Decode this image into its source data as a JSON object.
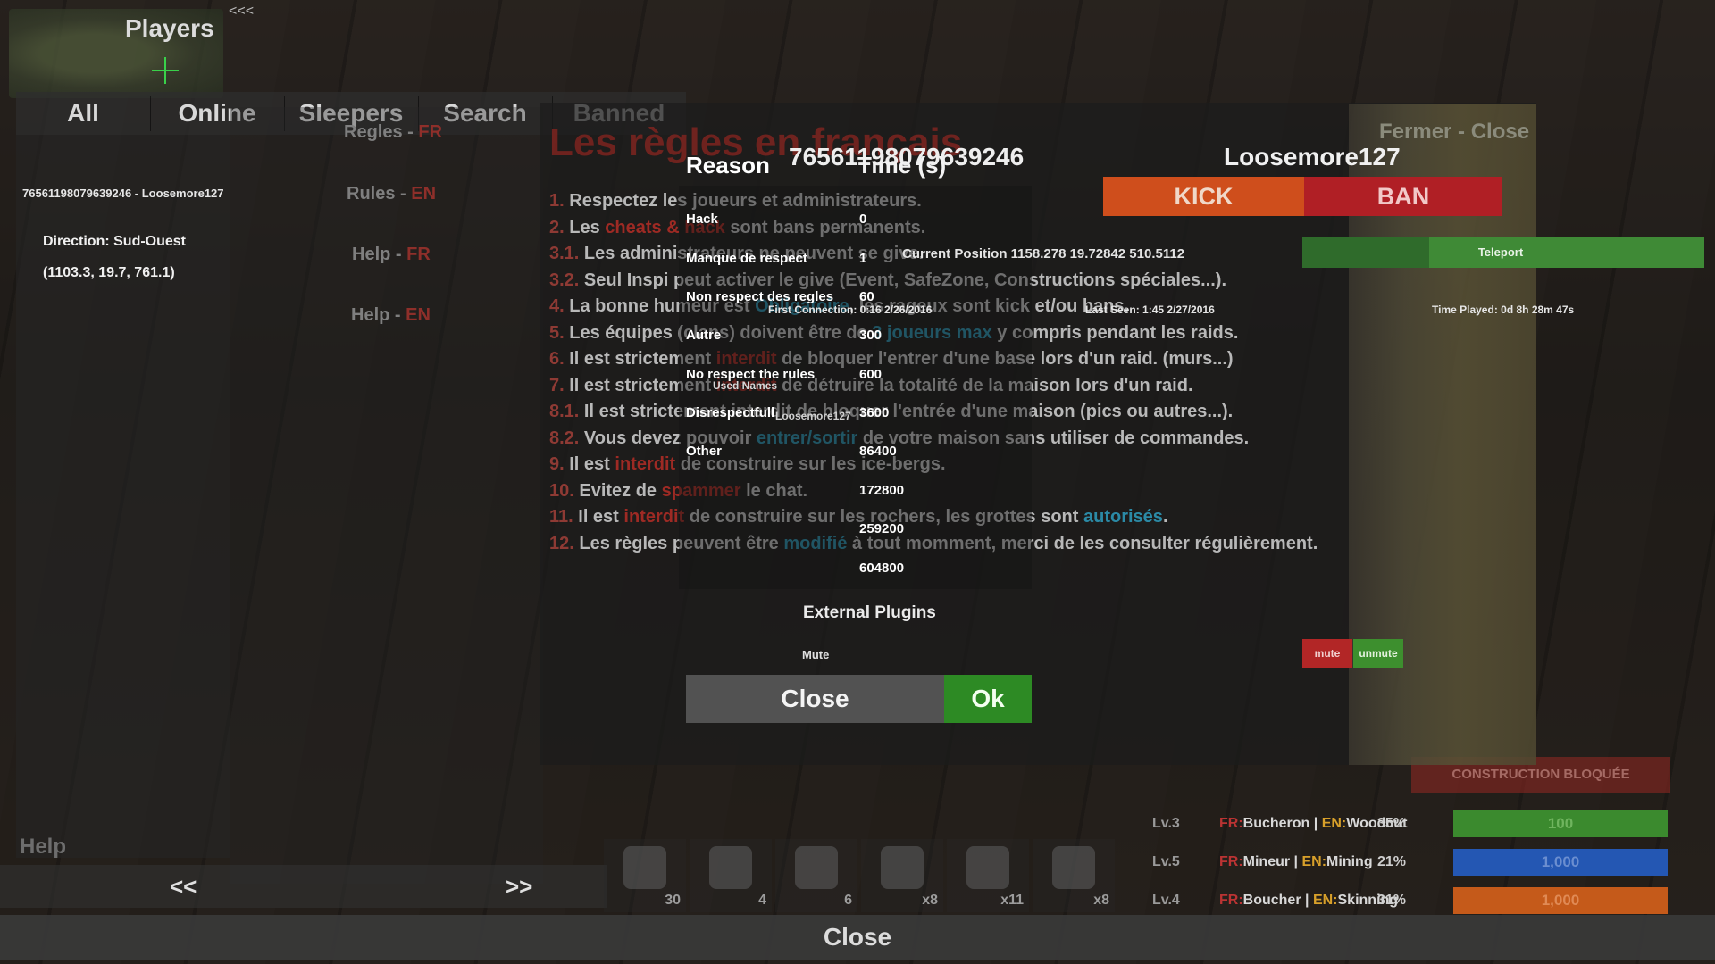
{
  "header": {
    "title": "Players",
    "collapse_label": "<<<",
    "tabs": [
      "All",
      "Online",
      "Sleepers",
      "Search",
      "Banned"
    ]
  },
  "left": {
    "player_entry": "76561198079639246 - Loosemore127",
    "direction": "Direction: Sud-Ouest",
    "coords": "(1103.3, 19.7, 761.1)",
    "help": "Help",
    "prev": "<<",
    "next": ">>"
  },
  "rules_nav": [
    {
      "label": "Regles - ",
      "lang": "FR"
    },
    {
      "label": "Rules - ",
      "lang": "EN"
    },
    {
      "label": "Help - ",
      "lang": "FR"
    },
    {
      "label": "Help - ",
      "lang": "EN"
    }
  ],
  "rules": {
    "title": "Les règles en français",
    "items": [
      [
        {
          "t": "1. ",
          "c": "n"
        },
        {
          "t": "Respectez les joueurs et administrateurs."
        }
      ],
      [
        {
          "t": "2. ",
          "c": "n"
        },
        {
          "t": "Les "
        },
        {
          "t": "cheats & hack",
          "c": "r"
        },
        {
          "t": " sont bans permanents."
        }
      ],
      [
        {
          "t": "3.1. ",
          "c": "n"
        },
        {
          "t": "Les administrateurs ne peuvent se give."
        }
      ],
      [
        {
          "t": "3.2. ",
          "c": "n"
        },
        {
          "t": "Seul Inspi peut activer le give (Event, SafeZone, Constructions spéciales...)."
        }
      ],
      [
        {
          "t": "4. ",
          "c": "n"
        },
        {
          "t": "La bonne humeur est "
        },
        {
          "t": "Obligatoire",
          "c": "b"
        },
        {
          "t": ", les rageux sont kick et/ou bans."
        }
      ],
      [
        {
          "t": "5. ",
          "c": "n"
        },
        {
          "t": "Les équipes (clans) doivent être de "
        },
        {
          "t": "3 joueurs max",
          "c": "b"
        },
        {
          "t": " y compris pendant les raids."
        }
      ],
      [
        {
          "t": "6. ",
          "c": "n"
        },
        {
          "t": "Il est strictement "
        },
        {
          "t": "interdit",
          "c": "r"
        },
        {
          "t": " de bloquer l'entrer d'une base lors d'un raid. (murs...)"
        }
      ],
      [
        {
          "t": "7. ",
          "c": "n"
        },
        {
          "t": "Il est strictement "
        },
        {
          "t": "interdit",
          "c": "r"
        },
        {
          "t": " de détruire la totalité de la maison lors d'un raid."
        }
      ],
      [
        {
          "t": "8.1. ",
          "c": "n"
        },
        {
          "t": "Il est strictement interdit de bloquer l'entrée d'une maison (pics ou autres...)."
        }
      ],
      [
        {
          "t": "8.2. ",
          "c": "n"
        },
        {
          "t": "Vous devez pouvoir "
        },
        {
          "t": "entrer/sortir",
          "c": "b"
        },
        {
          "t": " de votre maison sans utiliser de commandes."
        }
      ],
      [
        {
          "t": "9. ",
          "c": "n"
        },
        {
          "t": "Il est "
        },
        {
          "t": "interdit",
          "c": "r"
        },
        {
          "t": " de construire sur les ice-bergs."
        }
      ],
      [
        {
          "t": "10. ",
          "c": "n"
        },
        {
          "t": "Evitez de "
        },
        {
          "t": "spammer",
          "c": "r"
        },
        {
          "t": " le chat."
        }
      ],
      [
        {
          "t": "11. ",
          "c": "n"
        },
        {
          "t": "Il est "
        },
        {
          "t": "interdit",
          "c": "r"
        },
        {
          "t": " de construire sur les rochers, les grottes sont "
        },
        {
          "t": "autorisés",
          "c": "b"
        },
        {
          "t": "."
        }
      ],
      [
        {
          "t": "12. ",
          "c": "n"
        },
        {
          "t": "Les règles peuvent être "
        },
        {
          "t": "modifié",
          "c": "b"
        },
        {
          "t": " à tout momment, merci de les consulter régulièrement."
        }
      ]
    ]
  },
  "modal": {
    "reason_header": "Reason",
    "time_header": "Time (s)",
    "steam_id": "76561198079639246",
    "player_name": "Loosemore127",
    "reasons": [
      "Hack",
      "Manque de respect",
      "Non respect des regles",
      "Autre",
      "No respect the rules",
      "Disrespectfull",
      "Other"
    ],
    "times": [
      "0",
      "1",
      "60",
      "300",
      "600",
      "3600",
      "86400",
      "172800",
      "259200",
      "604800"
    ],
    "kick": "KICK",
    "ban": "BAN",
    "teleport": "Teleport",
    "current_position": "Current Position 1158.278 19.72842 510.5112",
    "first_connection": "First Connection: 0:16 2/26/2016",
    "last_seen": "Last Seen: 1:45 2/27/2016",
    "time_played": "Time Played: 0d 8h 28m 47s",
    "used_names_label": "Used Names",
    "used_name_1": "Loosemore127",
    "external_plugins": "External Plugins",
    "mute_label": "Mute",
    "mute": "mute",
    "unmute": "unmute",
    "close": "Close",
    "ok": "Ok"
  },
  "fermer": "Fermer - Close",
  "bottom_close": "Close",
  "hud": {
    "construction": "CONSTRUCTION BLOQUÉE",
    "skills": [
      {
        "level": "Lv.3",
        "fr": "FR:",
        "fr_name": "Bucheron",
        "en": "EN:",
        "en_name": "Woodcut",
        "pct": "35%",
        "bar_value": "100",
        "color": "#3b8a2e"
      },
      {
        "level": "Lv.5",
        "fr": "FR:",
        "fr_name": "Mineur",
        "en": "EN:",
        "en_name": "Mining",
        "pct": "21%",
        "bar_value": "1,000",
        "color": "#2457b3"
      },
      {
        "level": "Lv.4",
        "fr": "FR:",
        "fr_name": "Boucher",
        "en": "EN:",
        "en_name": "Skinning",
        "pct": "31%",
        "bar_value": "1,000",
        "color": "#c55a1a"
      }
    ]
  },
  "hotbar": [
    "30",
    "4",
    "6",
    "x8",
    "x11",
    "x8"
  ]
}
